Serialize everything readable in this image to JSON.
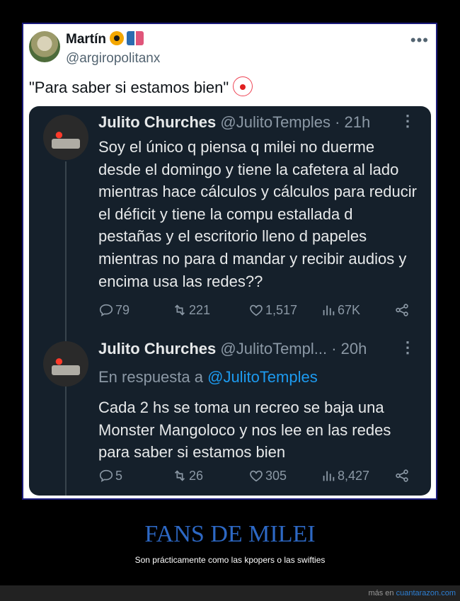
{
  "quote_tweet": {
    "author_name": "Martín",
    "handle": "@argiropolitanx",
    "text": "\"Para saber si estamos bien\"",
    "emoji_after_name": [
      "radioactive-icon",
      "couple-icon"
    ],
    "emoji_after_text": "clown-icon"
  },
  "tweets": [
    {
      "name": "Julito Churches",
      "meta": "@JulitoTemples · 21h",
      "text": "Soy el único q piensa q milei no duerme desde el domingo y tiene la cafetera al lado mientras hace cálculos y cálculos para reducir el déficit y tiene la compu estallada d pestañas y el escritorio lleno d papeles mientras no para d mandar y recibir audios y encima usa las redes??",
      "replies": "79",
      "retweets": "221",
      "likes": "1,517",
      "views": "67K"
    },
    {
      "name": "Julito Churches",
      "meta": "@JulitoTempl... · 20h",
      "reply_prefix": "En respuesta a",
      "reply_handle": "@JulitoTemples",
      "text": "Cada 2 hs se toma un recreo se baja una Monster Mangoloco y nos lee en las redes para saber si estamos bien",
      "replies": "5",
      "retweets": "26",
      "likes": "305",
      "views": "8,427"
    }
  ],
  "footer": {
    "title": "FANS DE MILEI",
    "subtitle": "Son prácticamente como las kpopers o las swifties",
    "credit_prefix": "más en",
    "credit_site": "cuantarazon.com"
  },
  "colors": {
    "accent_link": "#1d9bf0",
    "card_bg": "#15202b",
    "footer_title": "#2d68c4"
  }
}
